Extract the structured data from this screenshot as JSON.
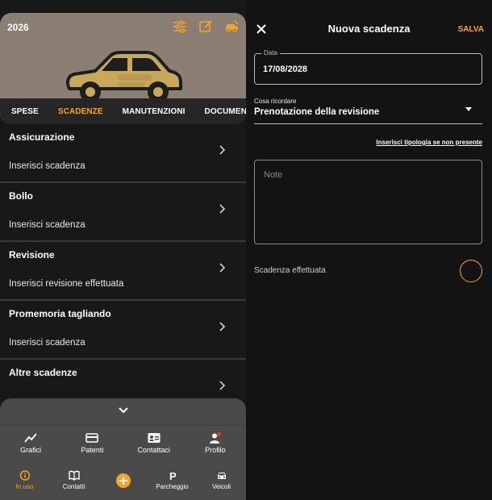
{
  "vehicle": {
    "year": "2026",
    "header_icons": [
      "tune-icon",
      "edit-icon",
      "car-service-icon"
    ]
  },
  "tabs": [
    {
      "label": "SPESE",
      "active": false
    },
    {
      "label": "SCADENZE",
      "active": true
    },
    {
      "label": "MANUTENZIONI",
      "active": false
    },
    {
      "label": "DOCUMENTI",
      "active": false
    }
  ],
  "deadlines": [
    {
      "title": "Assicurazione",
      "subtitle": "Inserisci scadenza"
    },
    {
      "title": "Bollo",
      "subtitle": "Inserisci scadenza"
    },
    {
      "title": "Revisione",
      "subtitle": "Inserisci revisione effettuata"
    },
    {
      "title": "Promemoria tagliando",
      "subtitle": "Inserisci scadenza"
    },
    {
      "title": "Altre scadenze",
      "subtitle": ""
    }
  ],
  "drawer_nav": [
    {
      "label": "Grafici",
      "icon": "chart-icon"
    },
    {
      "label": "Patenti",
      "icon": "card-icon"
    },
    {
      "label": "Contattaci",
      "icon": "contact-card-icon"
    },
    {
      "label": "Profilo",
      "icon": "profile-icon",
      "badge": true
    }
  ],
  "bottom_nav": [
    {
      "label": "In uso",
      "icon": "info-icon",
      "active": true
    },
    {
      "label": "Contatti",
      "icon": "book-icon",
      "active": false
    },
    {
      "label": "",
      "icon": "add-icon",
      "active": false
    },
    {
      "label": "Parcheggio",
      "icon": "parking-icon",
      "active": false
    },
    {
      "label": "Veicoli",
      "icon": "car-icon",
      "active": false
    }
  ],
  "form": {
    "title": "Nuova scadenza",
    "save_label": "SALVA",
    "date_label": "Data",
    "date_value": "17/08/2028",
    "reminder_label": "Cosa ricordare",
    "reminder_value": "Prenotazione della revisione",
    "custom_type_link": "Inserisci tipologia se non presente",
    "notes_placeholder": "Note",
    "done_label": "Scadenza effettuata",
    "done_checked": false
  },
  "colors": {
    "accent": "#f5a623",
    "background": "#131313",
    "hero": "#8a7f72",
    "badge": "#e53935"
  }
}
